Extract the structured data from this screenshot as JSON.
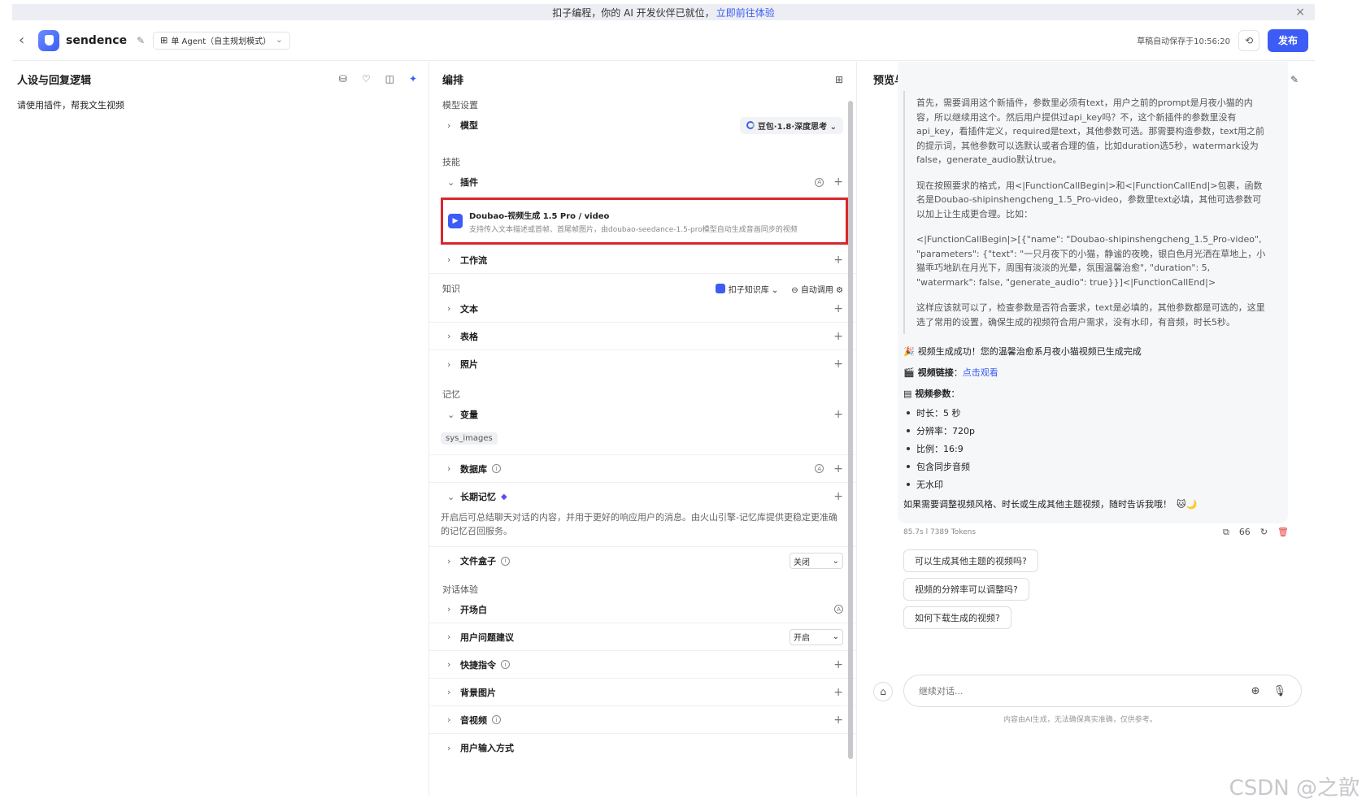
{
  "banner": {
    "text": "扣子编程，你的 AI 开发伙伴已就位，",
    "link": "立即前往体验",
    "close": "×"
  },
  "header": {
    "back": "‹",
    "app_name": "sendence",
    "edit_icon": "✎",
    "mode_icon": "⊞",
    "mode": "单 Agent（自主规划模式）",
    "mode_chevron": "⌄",
    "save_status": "草稿自动保存于10:56:20",
    "history_icon": "⟲",
    "publish": "发布"
  },
  "persona": {
    "title": "人设与回复逻辑",
    "icons": [
      "⛁",
      "♡",
      "◫",
      "✦"
    ],
    "prompt": "请使用插件，帮我文生视频"
  },
  "arrange": {
    "title": "编排",
    "layout_icon": "⊞",
    "model_section": "模型设置",
    "model_label": "模型",
    "model_value": "豆包·1.8·深度思考 ⌄",
    "skills_section": "技能",
    "plugins_label": "插件",
    "plugin": {
      "icon": "▶",
      "name": "Doubao-视频生成 1.5 Pro / video",
      "desc": "支持传入文本描述或首帧、首尾帧图片，由doubao-seedance-1.5-pro模型自动生成音画同步的视频"
    },
    "workflow_label": "工作流",
    "knowledge_section": "知识",
    "kb_select": "扣子知识库 ⌄",
    "auto_call": "⊖ 自动调用 ⚙",
    "text_label": "文本",
    "table_label": "表格",
    "photo_label": "照片",
    "memory_section": "记忆",
    "variables_label": "变量",
    "variable_tag": "sys_images",
    "database_label": "数据库",
    "ltm_label": "长期记忆",
    "ltm_gem": "◆",
    "ltm_desc": "开启后可总结聊天对话的内容，并用于更好的响应用户的消息。由火山引擎-记忆库提供更稳定更准确的记忆召回服务。",
    "filebox_label": "文件盒子",
    "filebox_value": "关闭",
    "dialog_section": "对话体验",
    "opening_label": "开场白",
    "suggest_label": "用户问题建议",
    "suggest_value": "开启",
    "shortcut_label": "快捷指令",
    "bg_label": "背景图片",
    "av_label": "音视频",
    "userinput_label": "用户输入方式",
    "chevron_right": "›",
    "chevron_down": "⌄",
    "plus": "+",
    "info": "i",
    "auto": "A",
    "select_caret": "⌄"
  },
  "preview": {
    "title": "预览与调试",
    "icons": [
      "▤⌄",
      "⚙⌄",
      "✎"
    ],
    "thinking": [
      "首先，需要调用这个新插件，参数里必须有text，用户之前的prompt是月夜小猫的内容，所以继续用这个。然后用户提供过api_key吗？不，这个新插件的参数里没有api_key，看插件定义，required是text，其他参数可选。那需要构造参数，text用之前的提示词，其他参数可以选默认或者合理的值，比如duration选5秒，watermark设为false，generate_audio默认true。",
      "现在按照要求的格式，用<|FunctionCallBegin|>和<|FunctionCallEnd|>包裹，函数名是Doubao-shipinshengcheng_1.5_Pro-video，参数里text必填，其他可选参数可以加上让生成更合理。比如：",
      "<|FunctionCallBegin|>[{\"name\": \"Doubao-shipinshengcheng_1.5_Pro-video\", \"parameters\": {\"text\": \"一只月夜下的小猫，静谧的夜晚，银白色月光洒在草地上，小猫乖巧地趴在月光下，周围有淡淡的光晕，氛围温馨治愈\", \"duration\": 5, \"watermark\": false, \"generate_audio\": true}}]<|FunctionCallEnd|>",
      "这样应该就可以了，检查参数是否符合要求，text是必填的，其他参数都是可选的，这里选了常用的设置，确保生成的视频符合用户需求，没有水印，有音频，时长5秒。"
    ],
    "success_emoji": "🎉",
    "success": "视频生成成功！您的温馨治愈系月夜小猫视频已生成完成",
    "link_emoji": "🎬",
    "link_label": "视频链接",
    "link_colon": "：",
    "link_text": "点击观看",
    "params_emoji": "▤",
    "params_label": "视频参数",
    "params_colon": "：",
    "params": [
      "时长：5 秒",
      "分辨率：720p",
      "比例：16:9",
      "包含同步音频",
      "无水印"
    ],
    "closing": "如果需要调整视频风格、时长或生成其他主题视频，随时告诉我哦！",
    "closing_emoji": "🐱🌙",
    "meta": "85.7s  ⅼ  7389 Tokens",
    "meta_icons": [
      "⧉",
      "66",
      "↻",
      "🗑"
    ],
    "suggestions": [
      "可以生成其他主题的视频吗?",
      "视频的分辨率可以调整吗?",
      "如何下载生成的视频?"
    ],
    "input_placeholder": "继续对话...",
    "left_icon": "⌂",
    "plus_icon": "⊕",
    "mic_icon": "🎙",
    "disclaimer": "内容由AI生成，无法确保真实准确，仅供参考。"
  },
  "watermark": "CSDN @之歆"
}
